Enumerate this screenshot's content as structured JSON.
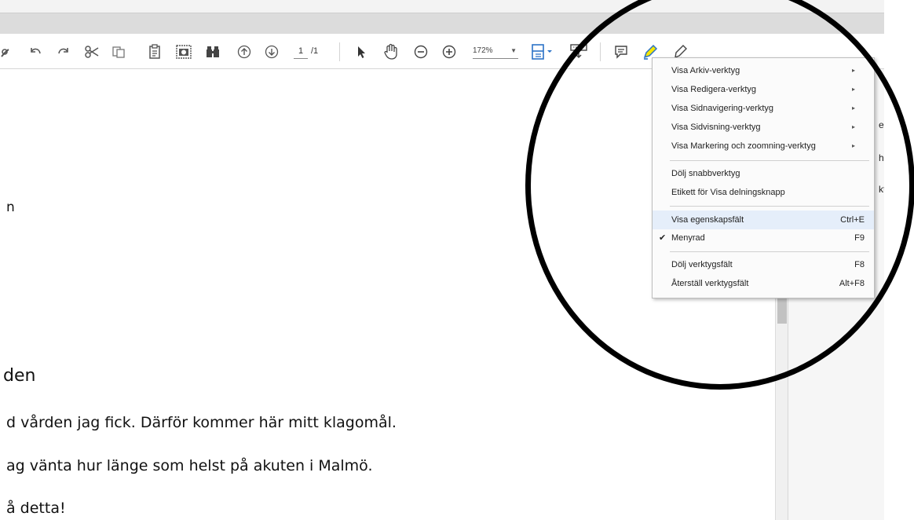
{
  "toolbar": {
    "page_current": "1",
    "page_total": "/1",
    "zoom": "172%"
  },
  "menu": {
    "items": [
      {
        "label": "Visa Arkiv-verktyg",
        "shortcut": "",
        "submenu": true
      },
      {
        "label": "Visa Redigera-verktyg",
        "shortcut": "",
        "submenu": true
      },
      {
        "label": "Visa Sidnavigering-verktyg",
        "shortcut": "",
        "submenu": true
      },
      {
        "label": "Visa Sidvisning-verktyg",
        "shortcut": "",
        "submenu": true
      },
      {
        "label": "Visa Markering och zoomning-verktyg",
        "shortcut": "",
        "submenu": true
      },
      {
        "label": "Dölj snabbverktyg",
        "shortcut": ""
      },
      {
        "label": "Etikett för Visa delningsknapp",
        "shortcut": ""
      },
      {
        "label": "Visa egenskapsfält",
        "shortcut": "Ctrl+E",
        "highlighted": true
      },
      {
        "label": "Menyrad",
        "shortcut": "F9",
        "checked": true
      },
      {
        "label": "Dölj verktygsfält",
        "shortcut": "F8"
      },
      {
        "label": "Återställ verktygsfält",
        "shortcut": "Alt+F8"
      }
    ],
    "check_glyph": "✔",
    "submenu_glyph": "▸"
  },
  "document": {
    "line_n": "n",
    "heading": "den",
    "p1": "d vården jag fick. Därför kommer här mitt klagomål.",
    "p2": "ag vänta hur länge som helst på akuten i Malmö.",
    "p3": "å detta!"
  },
  "right_panel": {
    "frag1": "en",
    "frag2": "h",
    "frag3": "kt"
  },
  "colors": {
    "highlight": "#e5eefa",
    "toolbar_icon": "#555555",
    "accent_blue": "#2b72c7",
    "highlighter_yellow": "#f5e600",
    "annotation_circle": "#000000"
  }
}
